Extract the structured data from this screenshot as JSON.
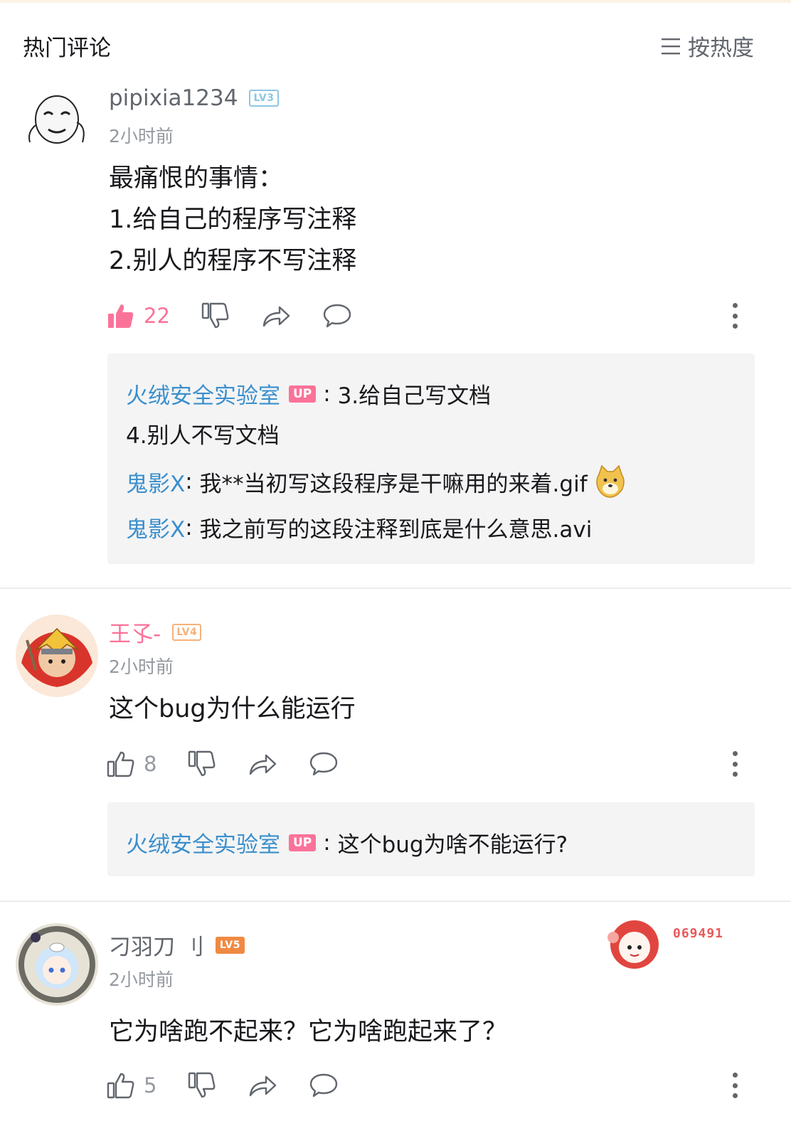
{
  "header": {
    "title": "热门评论",
    "sort_label": "按热度"
  },
  "comments": [
    {
      "username": "pipixia1234",
      "level": "LV3",
      "time": "2小时前",
      "text": [
        "最痛恨的事情：",
        "1.给自己的程序写注释",
        "2.别人的程序不写注释"
      ],
      "likes": "22",
      "liked": true,
      "replies": [
        {
          "name": "火绒安全实验室",
          "badge": "UP",
          "sep": ":",
          "text": " 3.给自己写文档"
        },
        {
          "name": "",
          "badge": "",
          "sep": "",
          "text": "4.别人不写文档"
        },
        {
          "name": "鬼影X",
          "badge": "",
          "sep": ":",
          "text": " 我**当初写这段程序是干嘛用的来着.gif"
        },
        {
          "name": "鬼影X",
          "badge": "",
          "sep": ":",
          "text": " 我之前写的这段注释到底是什么意思.avi"
        }
      ]
    },
    {
      "username": "王孓-",
      "level": "LV4",
      "time": "2小时前",
      "text": [
        "这个bug为什么能运行"
      ],
      "likes": "8",
      "liked": false,
      "replies": [
        {
          "name": "火绒安全实验室",
          "badge": "UP",
          "sep": ":",
          "text": " 这个bug为啥不能运行?"
        }
      ]
    },
    {
      "username": "刁羽刀 刂",
      "level": "LV5",
      "time": "2小时前",
      "text": [
        "它为啥跑不起来？它为啥跑起来了？"
      ],
      "likes": "5",
      "liked": false,
      "fan_number": "069491",
      "replies": []
    }
  ],
  "colors": {
    "accent_pink": "#fb7299",
    "reply_name_blue": "#3a8fcc",
    "lv3": "#8cc6e6",
    "lv4": "#f6b17a",
    "lv5": "#f08a42"
  }
}
